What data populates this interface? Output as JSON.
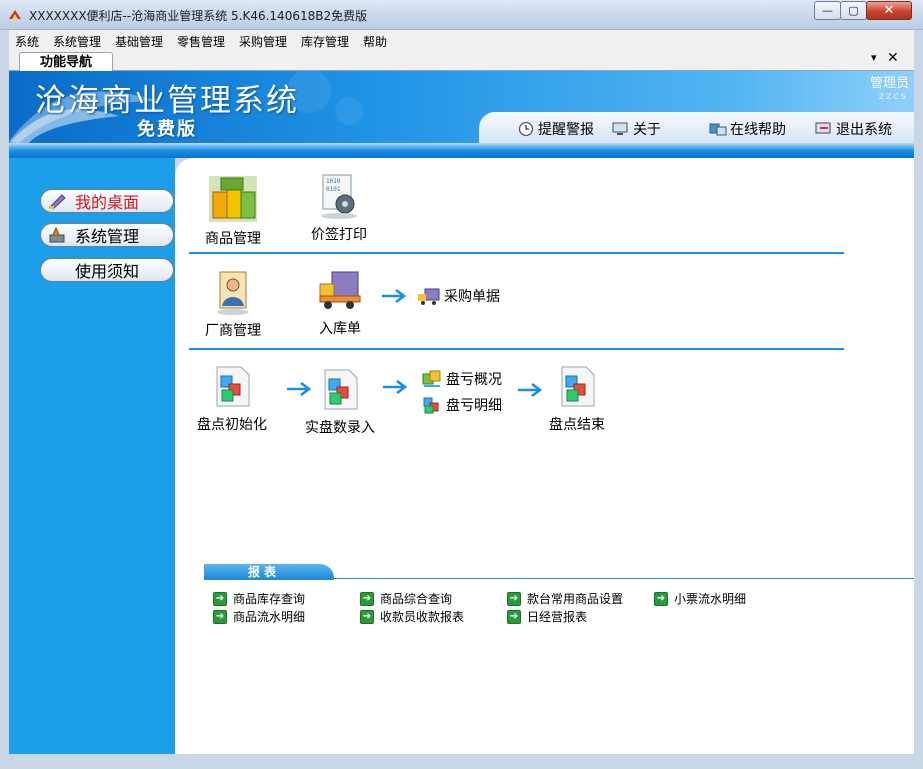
{
  "window": {
    "title": "XXXXXXX便利店--沧海商业管理系统 5.K46.140618B2免费版",
    "min_glyph": "—",
    "max_glyph": "▢",
    "close_glyph": "✕"
  },
  "menu": [
    "系统",
    "系统管理",
    "基础管理",
    "零售管理",
    "采购管理",
    "库存管理",
    "帮助"
  ],
  "tabstrip": {
    "active_tab": "功能导航",
    "dropdown_glyph": "▾",
    "close_glyph": "✕"
  },
  "banner": {
    "app_name": "沧海商业管理系统",
    "edition": "免费版",
    "user_role": "管理员",
    "user_name": "zzcs",
    "toolbar": [
      "提醒警报",
      "关于",
      "在线帮助",
      "退出系统"
    ]
  },
  "left_nav": [
    "我的桌面",
    "系统管理",
    "使用须知"
  ],
  "desktop": {
    "row1": [
      "商品管理",
      "价签打印"
    ],
    "row2": [
      "厂商管理",
      "入库单",
      "采购单据"
    ],
    "row3": [
      "盘点初始化",
      "实盘数录入",
      "盘亏概况",
      "盘亏明细",
      "盘点结束"
    ]
  },
  "reports": {
    "header": "报表",
    "items": [
      "商品库存查询",
      "商品综合查询",
      "款台常用商品设置",
      "小票流水明细",
      "商品流水明细",
      "收款员收款报表",
      "日经营报表"
    ],
    "icon_glyph": "➔"
  },
  "colors": {
    "accent": "#1a8fe0",
    "left_panel": "#1d9ee8",
    "active_nav_text": "#d11a1a",
    "report_icon": "#2a9b3a"
  }
}
